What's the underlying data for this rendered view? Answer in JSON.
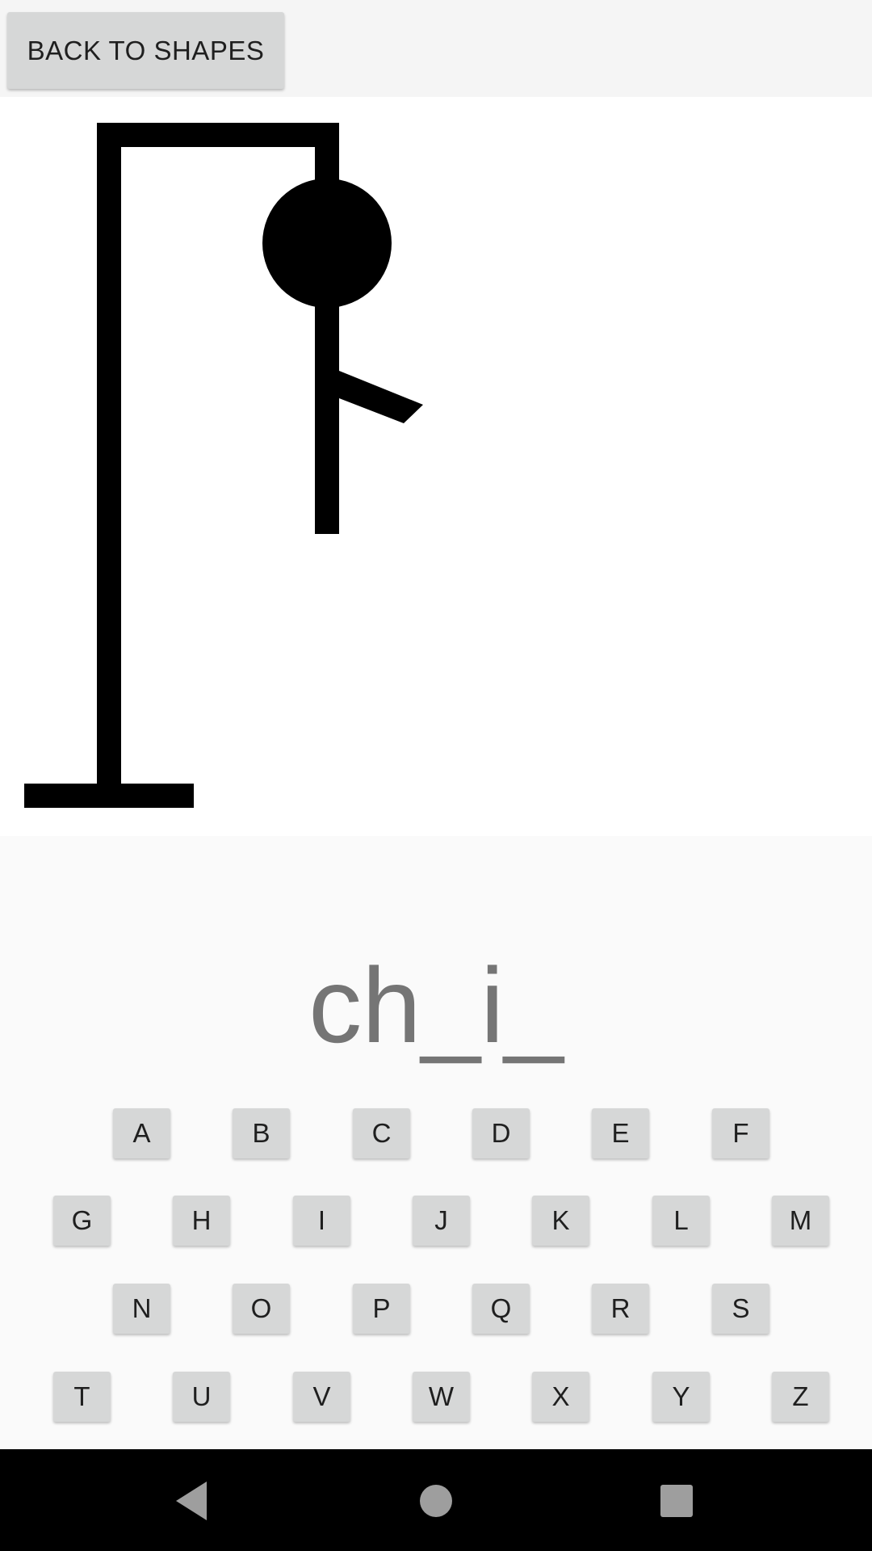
{
  "toolbar": {
    "back_label": "BACK TO SHAPES"
  },
  "game": {
    "word_display": "ch_i_",
    "parts_drawn": [
      "gallows",
      "head",
      "body",
      "left-arm"
    ]
  },
  "keyboard": {
    "rows": [
      [
        "A",
        "B",
        "C",
        "D",
        "E",
        "F"
      ],
      [
        "G",
        "H",
        "I",
        "J",
        "K",
        "L",
        "M"
      ],
      [
        "N",
        "O",
        "P",
        "Q",
        "R",
        "S"
      ],
      [
        "T",
        "U",
        "V",
        "W",
        "X",
        "Y",
        "Z"
      ]
    ]
  },
  "colors": {
    "background": "#fafafa",
    "canvas": "#ffffff",
    "ink": "#000000",
    "key": "#d6d7d7",
    "word": "#757575",
    "navbar": "#000000",
    "nav_icon": "#9e9e9e"
  },
  "navbar": {
    "icons": [
      "back-icon",
      "home-icon",
      "recents-icon"
    ]
  }
}
